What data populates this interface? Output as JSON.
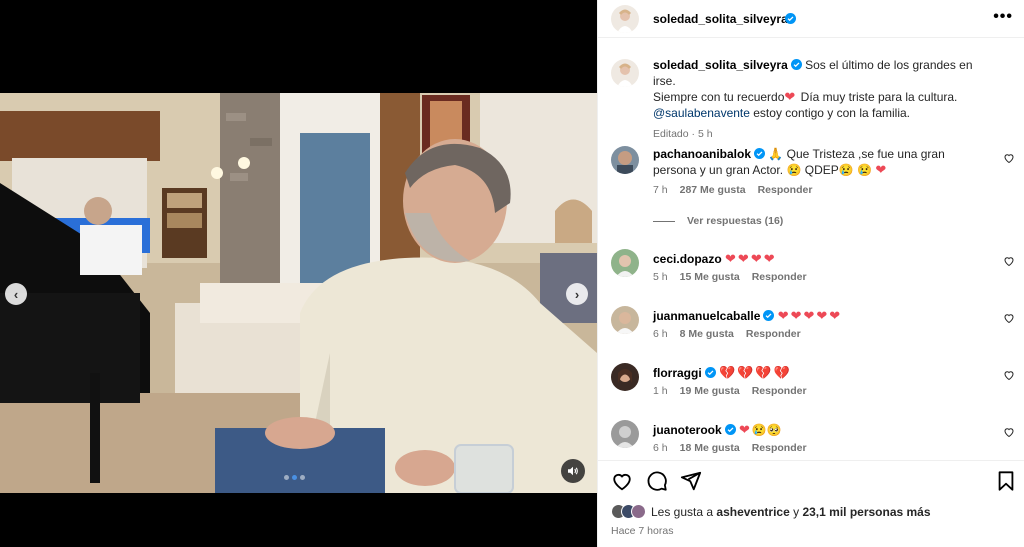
{
  "post": {
    "author": "soledad_solita_silveyra",
    "more_icon": "more-horizontal-icon",
    "carousel": {
      "total": 3,
      "current": 2
    }
  },
  "caption": {
    "username": "soledad_solita_silveyra",
    "line1": "Sos el último de los grandes en irse.",
    "line2": "Siempre con tu recuerdo",
    "line2b": " Día muy triste para la cultura.",
    "mention": "@saulabenavente",
    "line3": " estoy contigo y con la familia.",
    "edited": "Editado",
    "time": "5 h"
  },
  "comments": [
    {
      "username": "pachanoanibalok",
      "text1": "Que Tristeza ,se fue una gran persona",
      "text2": "y un gran Actor.",
      "text3": "QDEP",
      "time": "7 h",
      "likes": "287 Me gusta",
      "reply": "Responder",
      "replies": "Ver respuestas (16)"
    },
    {
      "username": "ceci.dopazo",
      "time": "5 h",
      "likes": "15 Me gusta",
      "reply": "Responder"
    },
    {
      "username": "juanmanuelcaballe",
      "time": "6 h",
      "likes": "8 Me gusta",
      "reply": "Responder"
    },
    {
      "username": "florraggi",
      "time": "1 h",
      "likes": "19 Me gusta",
      "reply": "Responder"
    },
    {
      "username": "juanoterook",
      "time": "6 h",
      "likes": "18 Me gusta",
      "reply": "Responder"
    }
  ],
  "likes": {
    "prefix": "Les gusta a ",
    "user": "asheventrice",
    "middle": " y ",
    "count": "23,1 mil personas más"
  },
  "time_ago": "Hace 7 horas",
  "colors": {
    "verified": "#0095f6",
    "heart": "#ed4956",
    "secondary_text": "#737373",
    "link": "#00376b"
  }
}
